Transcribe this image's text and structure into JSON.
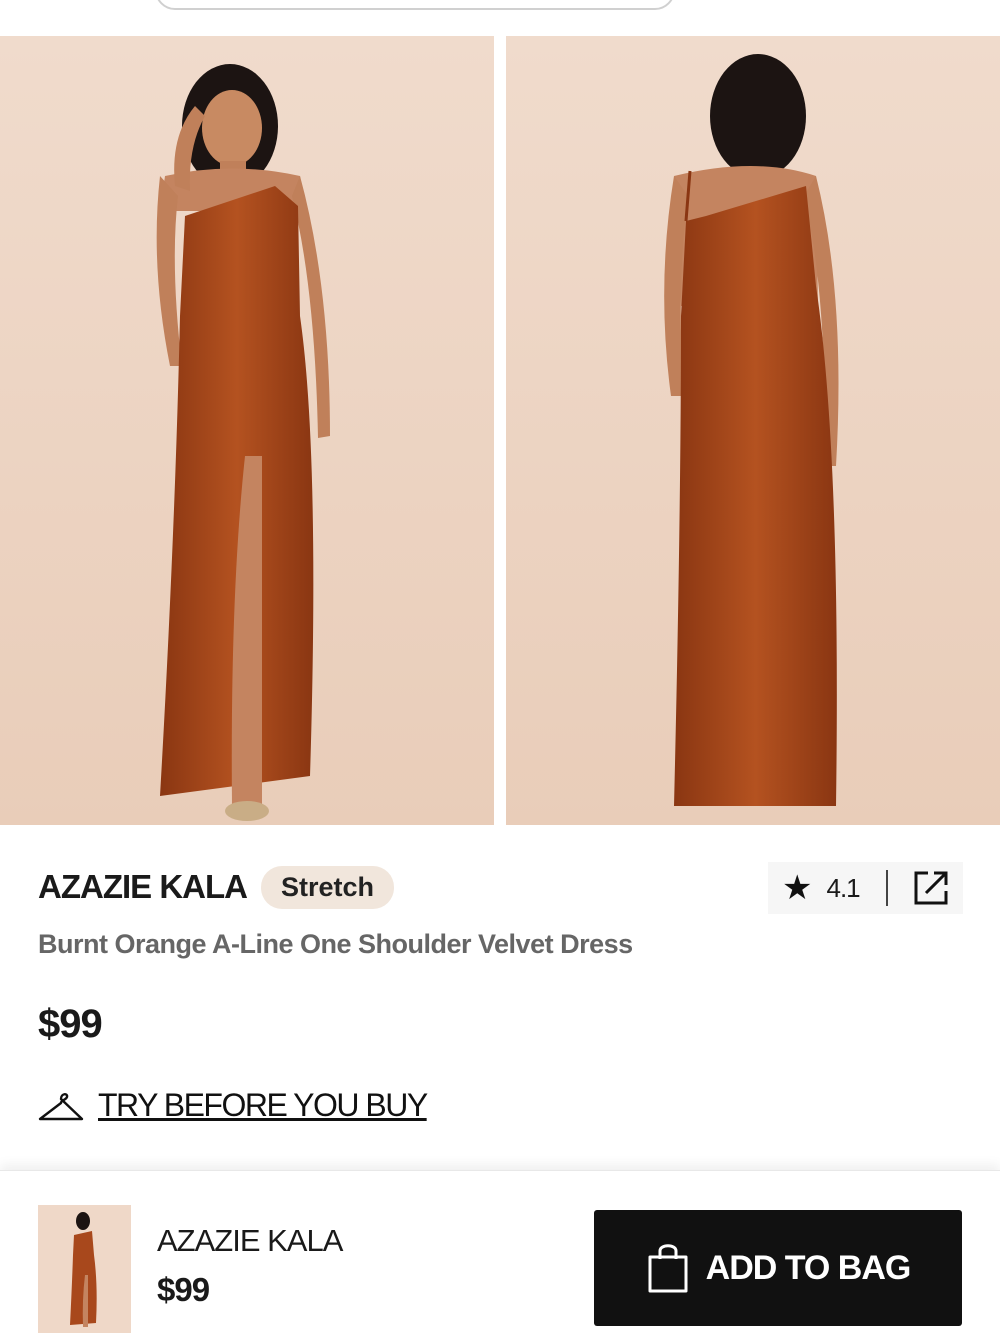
{
  "product": {
    "brand": "AZAZIE KALA",
    "badge": "Stretch",
    "name": "Burnt Orange A-Line One Shoulder Velvet Dress",
    "price": "$99",
    "rating": "4.1"
  },
  "try_before": {
    "label": "TRY BEFORE YOU BUY"
  },
  "bottom_bar": {
    "brand": "AZAZIE KALA",
    "price": "$99",
    "add_to_bag_label": "ADD TO BAG"
  },
  "colors": {
    "dress": "#a8481c",
    "backdrop": "#efd8c8",
    "button": "#111111",
    "badge_bg": "#f1e6dc"
  },
  "icons": [
    "star-icon",
    "share-icon",
    "hanger-icon",
    "shopping-bag-icon"
  ]
}
